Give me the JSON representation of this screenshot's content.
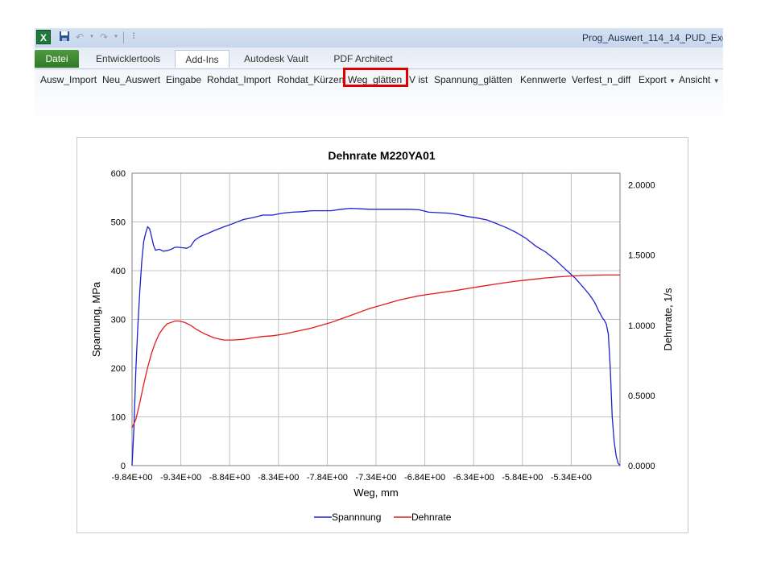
{
  "window": {
    "title": "Prog_Auswert_114_14_PUD_Exce",
    "app_icon_letter": "X",
    "quick_access": {
      "save_icon": "save-icon",
      "undo_icon": "undo-icon",
      "redo_icon": "redo-icon",
      "customize_icon": "customize-icon"
    }
  },
  "tabs": [
    {
      "label": "Datei",
      "active": false
    },
    {
      "label": "Entwicklertools",
      "active": false
    },
    {
      "label": "Add-Ins",
      "active": true
    },
    {
      "label": "Autodesk Vault",
      "active": false
    },
    {
      "label": "PDF Architect",
      "active": false
    }
  ],
  "ribbon": {
    "buttons": [
      "Ausw_Import",
      "Neu_Auswert",
      "Eingabe",
      "Rohdat_Import",
      "Rohdat_Kürzen",
      "Weg_glätten",
      "V ist",
      "Spannung_glätten",
      "Kennwerte",
      "Verfest_n_diff",
      "Export",
      "Ansicht"
    ],
    "dropdown_buttons": [
      "Export",
      "Ansicht"
    ],
    "highlighted": "Weg_glätten"
  },
  "colors": {
    "file_tab": "#3a8a2e",
    "highlight": "#e00000",
    "series1": "#1f1fd0",
    "series2": "#e31a1c"
  },
  "chart_data": {
    "type": "line",
    "title": "Dehnrate M220YA01",
    "xlabel": "Weg, mm",
    "ylabel": "Spannung, MPa",
    "y2label": "Dehnrate, 1/s",
    "xlim": [
      -9.84,
      -4.84
    ],
    "ylim": [
      0,
      600
    ],
    "y2lim": [
      0,
      2.0833
    ],
    "x_ticks": [
      -9.84,
      -9.34,
      -8.84,
      -8.34,
      -7.84,
      -7.34,
      -6.84,
      -6.34,
      -5.84,
      -5.34
    ],
    "x_tick_labels": [
      "-9.84E+00",
      "-9.34E+00",
      "-8.84E+00",
      "-8.34E+00",
      "-7.84E+00",
      "-7.34E+00",
      "-6.84E+00",
      "-6.34E+00",
      "-5.84E+00",
      "-5.34E+00"
    ],
    "y_ticks": [
      0,
      100,
      200,
      300,
      400,
      500,
      600
    ],
    "y_tick_labels": [
      "0",
      "100",
      "200",
      "300",
      "400",
      "500",
      "600"
    ],
    "y2_ticks": [
      0,
      0.5,
      1.0,
      1.5,
      2.0
    ],
    "y2_tick_labels": [
      "0.0000",
      "0.5000",
      "1.0000",
      "1.5000",
      "2.0000"
    ],
    "grid": true,
    "legend": "bottom",
    "series": [
      {
        "name": "Spannnung",
        "axis": "left",
        "color": "#1f1fd0",
        "x": [
          -9.84,
          -9.82,
          -9.8,
          -9.78,
          -9.76,
          -9.74,
          -9.72,
          -9.7,
          -9.68,
          -9.66,
          -9.64,
          -9.62,
          -9.6,
          -9.58,
          -9.56,
          -9.52,
          -9.48,
          -9.44,
          -9.4,
          -9.36,
          -9.32,
          -9.28,
          -9.24,
          -9.2,
          -9.14,
          -9.08,
          -9.0,
          -8.9,
          -8.8,
          -8.7,
          -8.6,
          -8.5,
          -8.4,
          -8.3,
          -8.2,
          -8.1,
          -8.0,
          -7.9,
          -7.8,
          -7.7,
          -7.6,
          -7.5,
          -7.4,
          -7.3,
          -7.2,
          -7.1,
          -7.0,
          -6.9,
          -6.8,
          -6.7,
          -6.6,
          -6.5,
          -6.4,
          -6.3,
          -6.2,
          -6.1,
          -6.0,
          -5.9,
          -5.8,
          -5.7,
          -5.6,
          -5.5,
          -5.4,
          -5.3,
          -5.2,
          -5.15,
          -5.1,
          -5.06,
          -5.02,
          -5.0,
          -4.98,
          -4.96,
          -4.94,
          -4.92,
          -4.9,
          -4.88,
          -4.86,
          -4.84
        ],
        "y": [
          0,
          80,
          200,
          290,
          360,
          420,
          460,
          478,
          490,
          486,
          470,
          452,
          442,
          443,
          444,
          440,
          441,
          444,
          448,
          448,
          447,
          446,
          450,
          462,
          470,
          475,
          482,
          490,
          497,
          505,
          509,
          514,
          514,
          518,
          520,
          521,
          523,
          523,
          523,
          526,
          528,
          527,
          526,
          526,
          526,
          526,
          526,
          525,
          520,
          519,
          518,
          515,
          511,
          508,
          504,
          496,
          488,
          478,
          466,
          450,
          438,
          422,
          403,
          385,
          362,
          350,
          335,
          318,
          303,
          298,
          290,
          270,
          200,
          100,
          50,
          20,
          5,
          0
        ]
      },
      {
        "name": "Dehnrate",
        "axis": "right",
        "color": "#e31a1c",
        "x": [
          -9.84,
          -9.8,
          -9.76,
          -9.72,
          -9.68,
          -9.64,
          -9.6,
          -9.56,
          -9.52,
          -9.48,
          -9.44,
          -9.4,
          -9.36,
          -9.3,
          -9.24,
          -9.18,
          -9.1,
          -9.0,
          -8.9,
          -8.8,
          -8.7,
          -8.6,
          -8.5,
          -8.4,
          -8.3,
          -8.2,
          -8.1,
          -8.0,
          -7.9,
          -7.8,
          -7.7,
          -7.6,
          -7.5,
          -7.4,
          -7.3,
          -7.2,
          -7.1,
          -7.0,
          -6.9,
          -6.8,
          -6.7,
          -6.6,
          -6.5,
          -6.4,
          -6.3,
          -6.2,
          -6.1,
          -6.0,
          -5.9,
          -5.8,
          -5.7,
          -5.6,
          -5.5,
          -5.4,
          -5.3,
          -5.2,
          -5.1,
          -5.0,
          -4.9,
          -4.84
        ],
        "y": [
          0.27,
          0.33,
          0.45,
          0.58,
          0.7,
          0.8,
          0.88,
          0.94,
          0.98,
          1.01,
          1.02,
          1.03,
          1.03,
          1.02,
          1.0,
          0.97,
          0.94,
          0.91,
          0.895,
          0.895,
          0.9,
          0.91,
          0.92,
          0.925,
          0.935,
          0.95,
          0.965,
          0.98,
          1.0,
          1.02,
          1.045,
          1.07,
          1.095,
          1.12,
          1.14,
          1.16,
          1.18,
          1.195,
          1.21,
          1.22,
          1.23,
          1.24,
          1.25,
          1.262,
          1.273,
          1.284,
          1.295,
          1.305,
          1.314,
          1.322,
          1.33,
          1.337,
          1.343,
          1.348,
          1.352,
          1.355,
          1.357,
          1.358,
          1.358,
          1.358
        ]
      }
    ]
  }
}
